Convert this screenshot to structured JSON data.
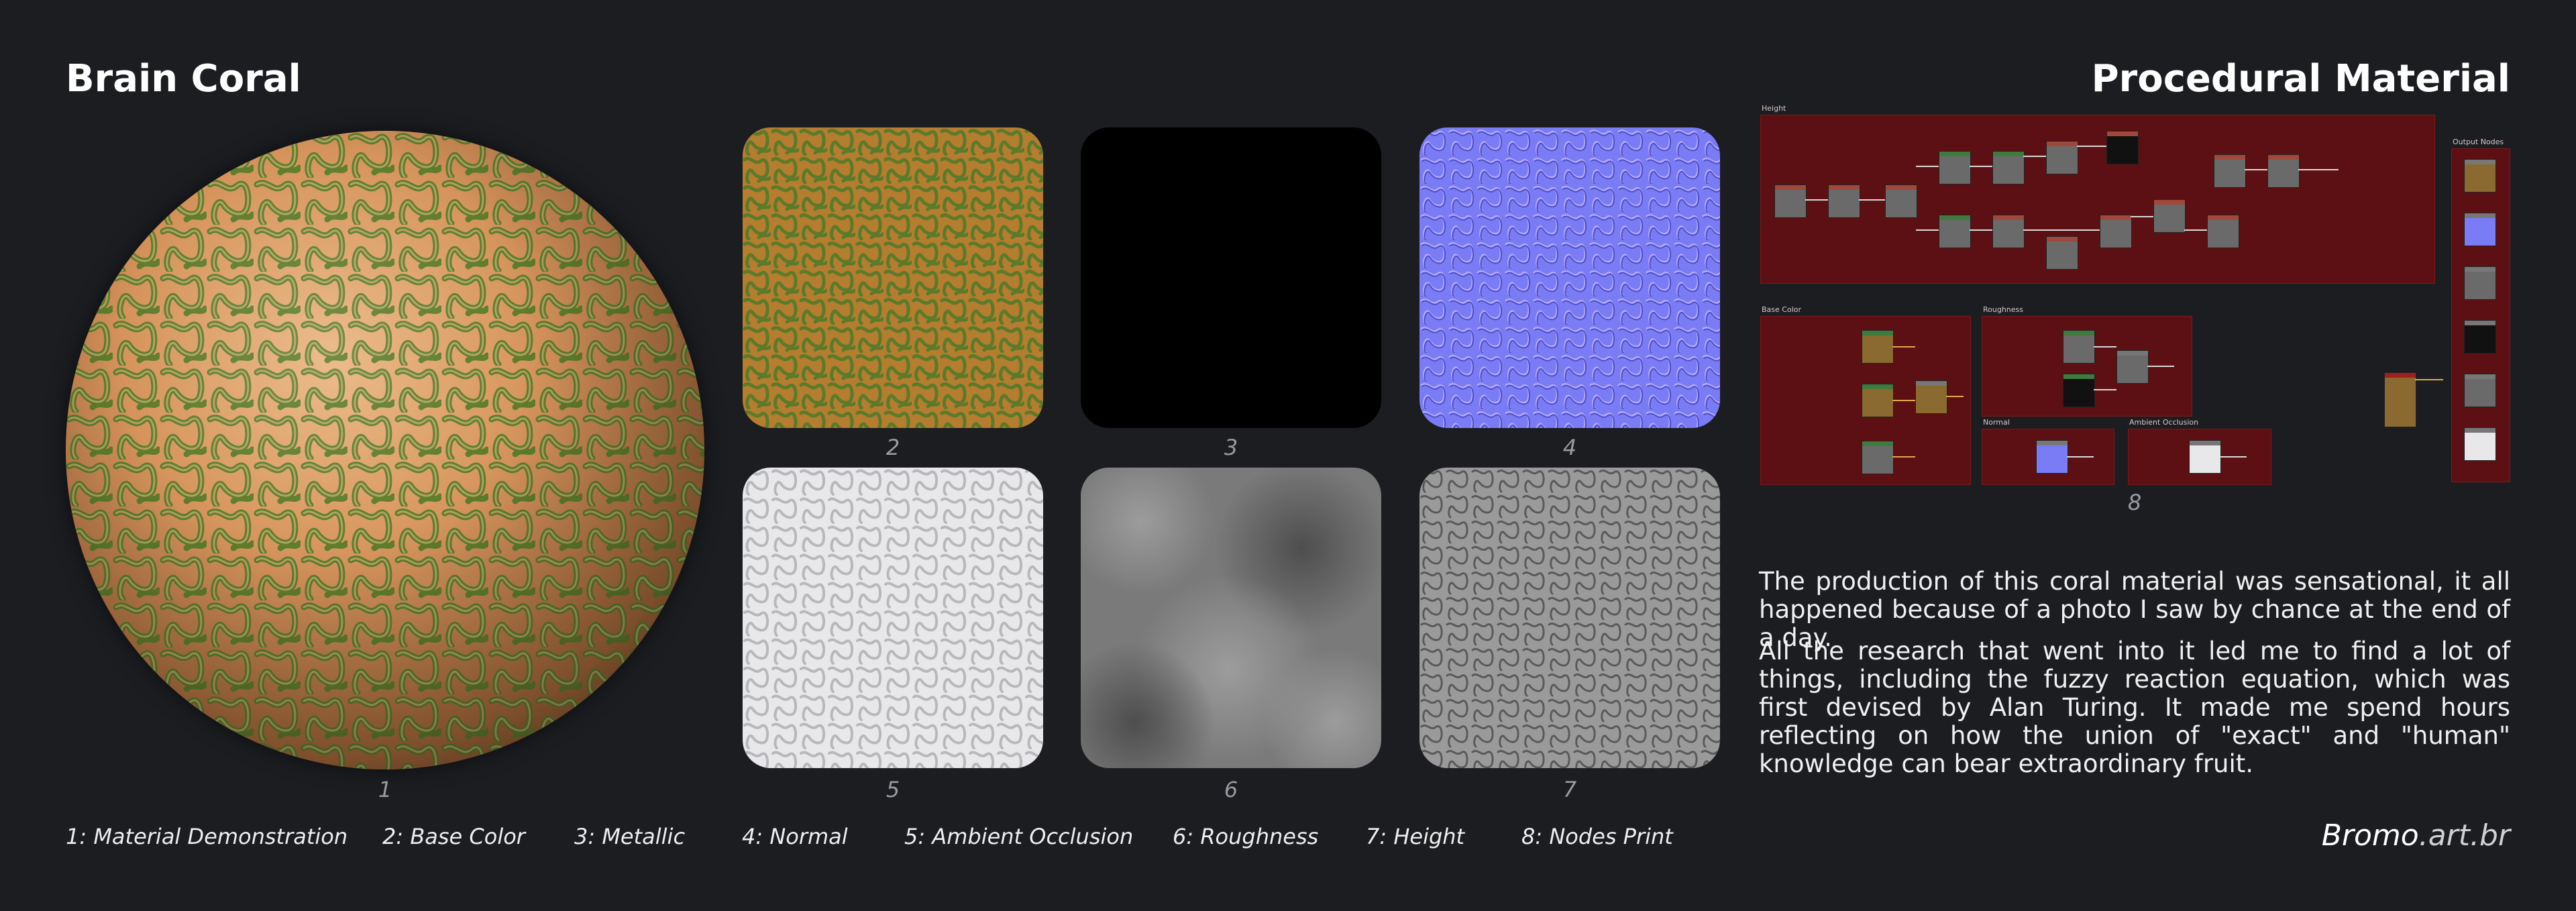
{
  "header": {
    "title_left": "Brain Coral",
    "title_right": "Procedural Material"
  },
  "tiles": [
    {
      "number": "1",
      "name": "material-demonstration"
    },
    {
      "number": "2",
      "color": "#b47d2f"
    },
    {
      "number": "3",
      "color": "#000000"
    },
    {
      "number": "4",
      "color": "#7a7cf6"
    },
    {
      "number": "5",
      "color": "#e8e8ea"
    },
    {
      "number": "6",
      "color": "#7a7a7a"
    },
    {
      "number": "7",
      "color": "#9a9a9a"
    },
    {
      "number": "8"
    }
  ],
  "nodes": {
    "height_label": "Height",
    "base_color_label": "Base Color",
    "roughness_label": "Roughness",
    "normal_label": "Normal",
    "ambient_occlusion_label": "Ambient Occlusion",
    "output_nodes_label": "Output Nodes",
    "panel_color": "#5c1013"
  },
  "description": {
    "p1": "The production of this coral material was sensational, it all happened because of a photo I saw by chance at the end of a day.",
    "p2": "All the research that went into it led me to find a lot of things, including the fuzzy reaction equation, which was first devised by Alan Turing. It made me spend hours reflecting on how the union of \"exact\" and \"human\" knowledge can bear extraordinary fruit."
  },
  "captions": [
    "1: Material Demonstration",
    "2: Base Color",
    "3: Metallic",
    "4: Normal",
    "5: Ambient Occlusion",
    "6: Roughness",
    "7: Height",
    "8: Nodes Print"
  ],
  "brand": {
    "main": "Bromo",
    "suffix": ".art.br"
  }
}
